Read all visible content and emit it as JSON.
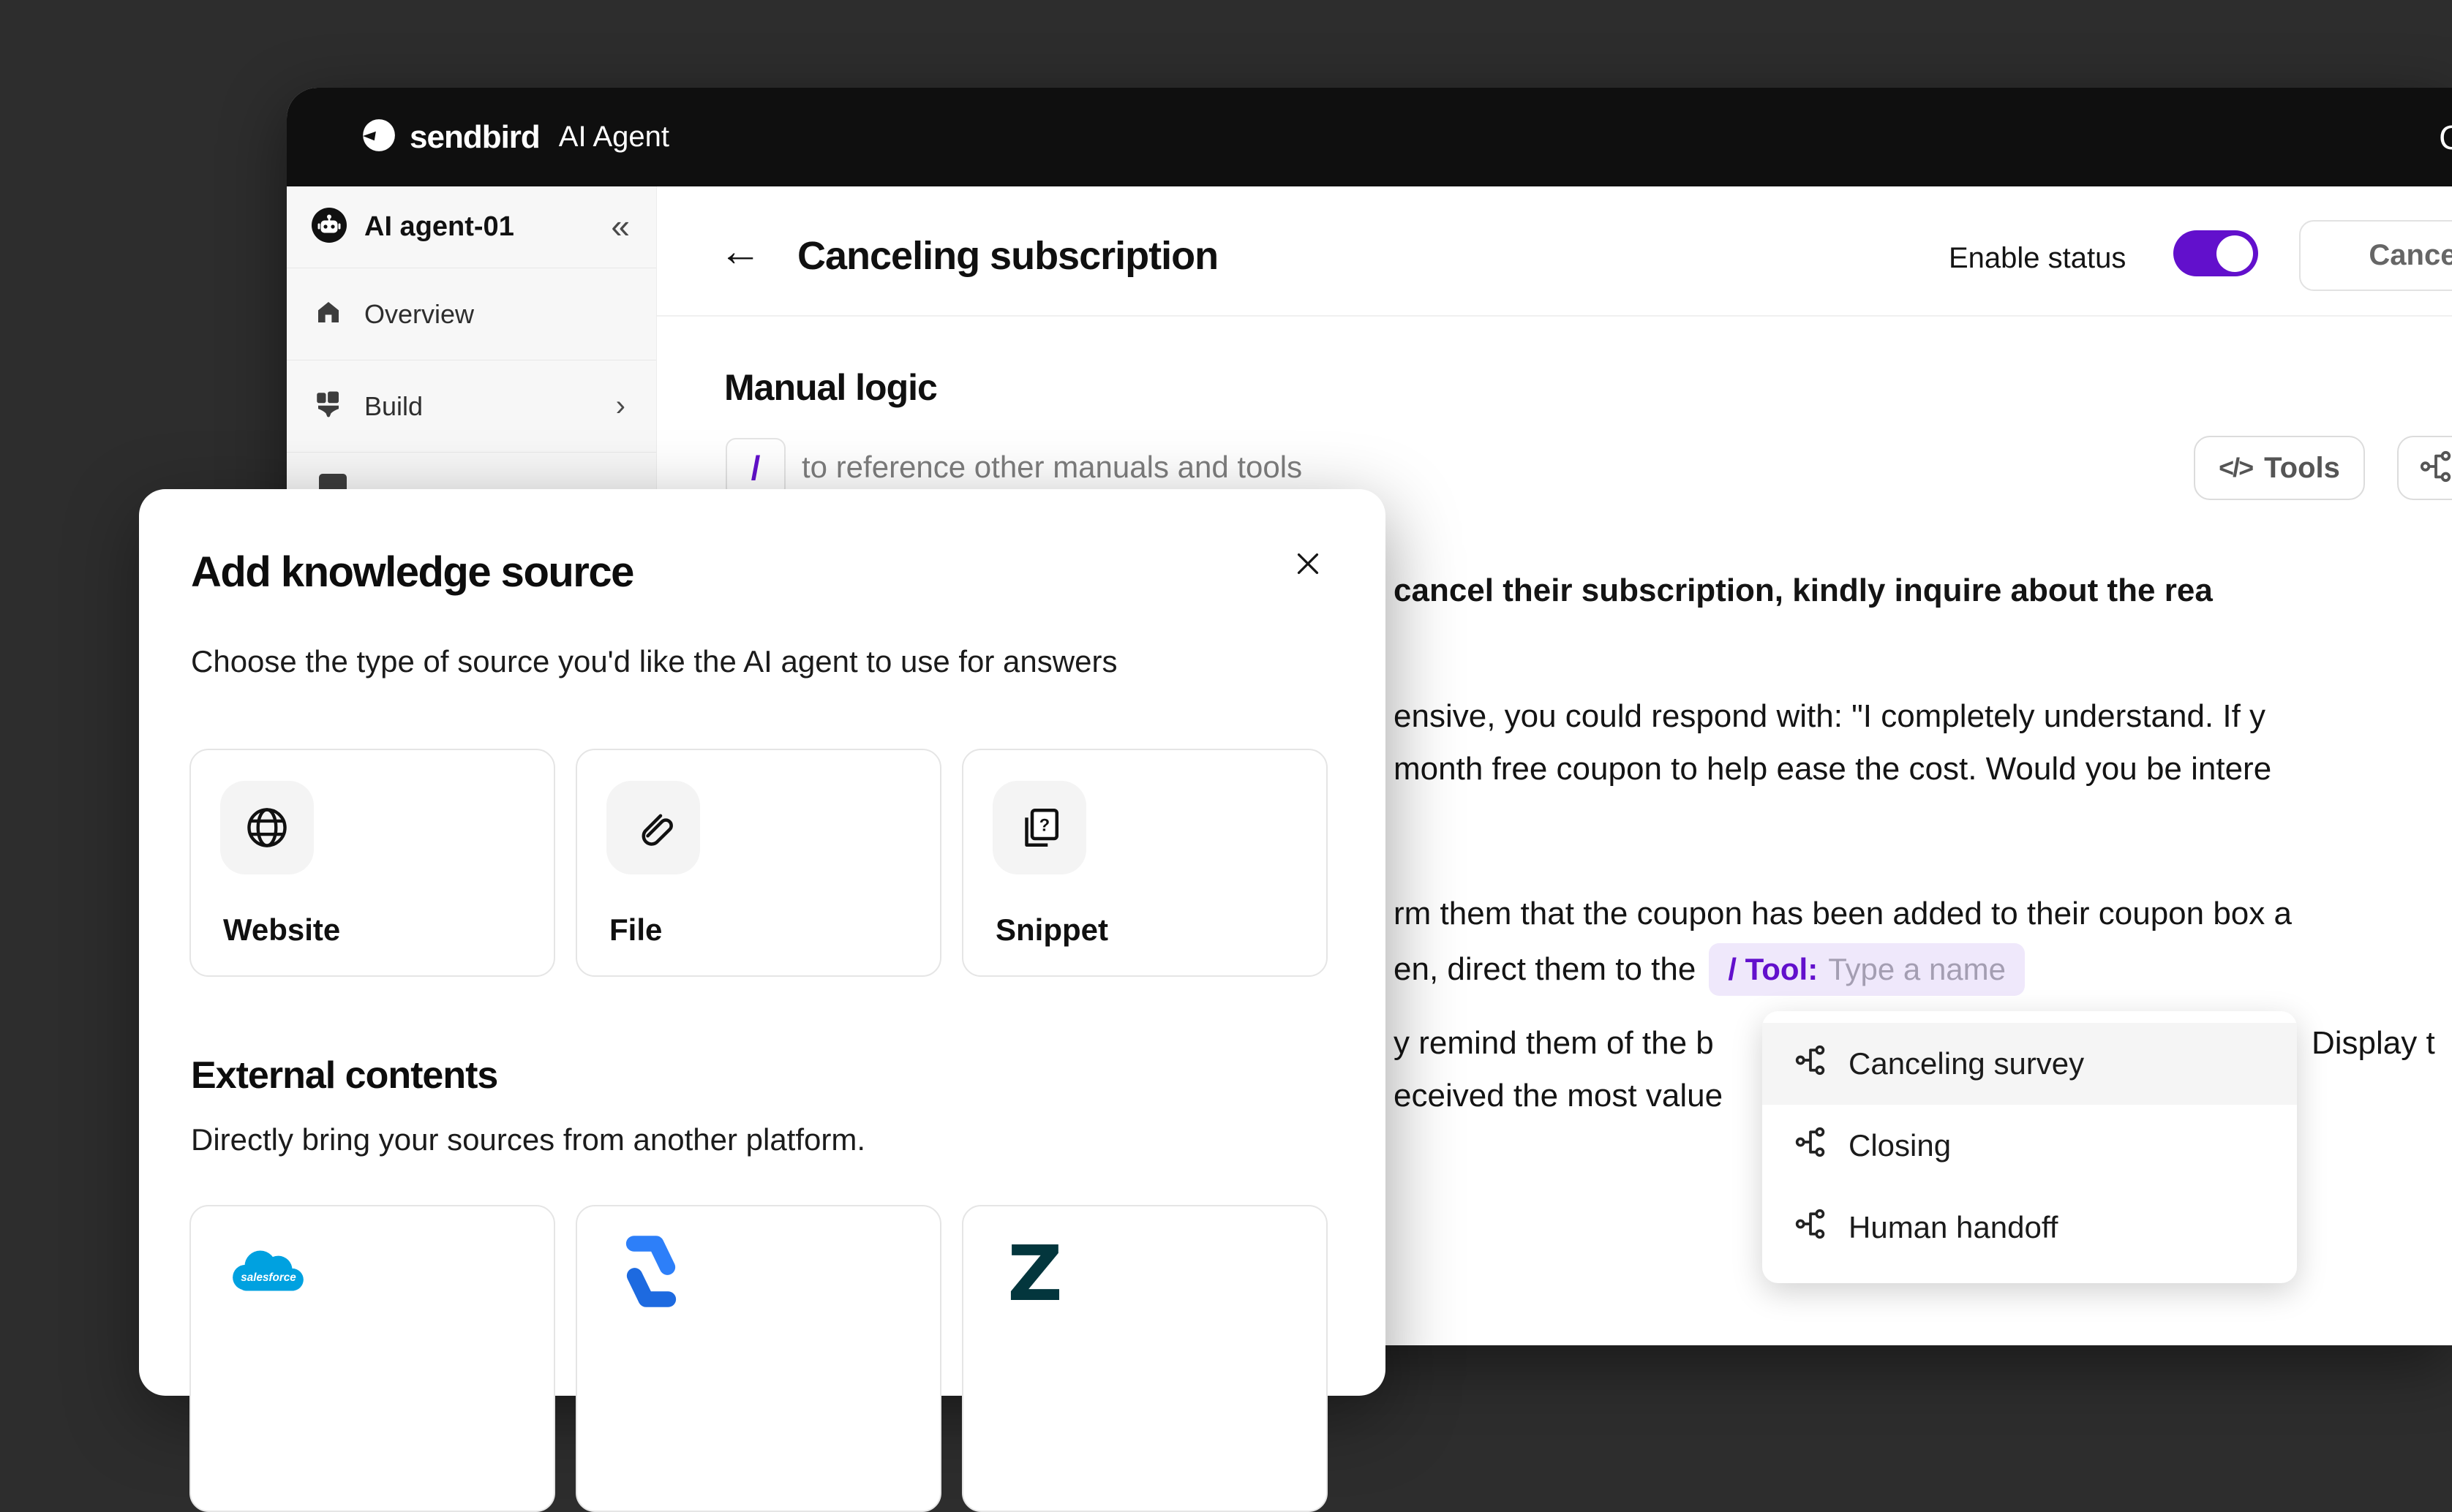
{
  "topbar": {
    "logo": "sendbird",
    "product": "AI Agent",
    "right_partial": "O"
  },
  "sidebar": {
    "agent_name": "AI agent-01",
    "collapse_glyph": "«",
    "items": [
      {
        "label": "Overview",
        "icon": "home-icon"
      },
      {
        "label": "Build",
        "icon": "brush-icon",
        "chevron": "›"
      }
    ]
  },
  "header": {
    "back_glyph": "←",
    "title": "Canceling subscription",
    "enable_status_label": "Enable status",
    "toggle_state": "on",
    "cancel_label": "Cancel"
  },
  "manual": {
    "section_title": "Manual logic",
    "slash": "/",
    "slash_hint": "to reference other manuals and tools",
    "tools_code_glyph": "</>",
    "tools_label": "Tools",
    "text": {
      "line1": "cancel their subscription, kindly inquire about the rea",
      "line2": "ensive, you could respond with: \"I completely understand. If y",
      "line3": "month free coupon to help ease the cost. Would you be intere",
      "line4": "rm them that the coupon has been added to their coupon box a",
      "line5_prefix": "en, direct them to the",
      "line6_left": "y remind them of the b",
      "line6_right": "Display t",
      "line7": "eceived the most value"
    },
    "tool_pill": {
      "trigger": "/ Tool:",
      "placeholder": "Type a name"
    },
    "dropdown": {
      "items": [
        "Canceling survey",
        "Closing",
        "Human handoff"
      ]
    }
  },
  "modal": {
    "title": "Add knowledge source",
    "subtitle": "Choose the type of source you'd like the AI agent to use for answers",
    "sources": [
      {
        "label": "Website",
        "icon": "globe-icon"
      },
      {
        "label": "File",
        "icon": "paperclip-icon"
      },
      {
        "label": "Snippet",
        "icon": "snippet-icon"
      }
    ],
    "external_title": "External contents",
    "external_subtitle": "Directly bring your sources from another platform.",
    "platforms": [
      {
        "icon": "salesforce-logo",
        "wordmark": "salesforce"
      },
      {
        "icon": "confluence-logo"
      },
      {
        "icon": "zendesk-logo",
        "glyph": "Z"
      }
    ]
  },
  "colors": {
    "accent_purple": "#6210CC",
    "topbar_bg": "#0F0F0F",
    "canvas_bg": "#2D2D2D",
    "sidebar_bg": "#F7F7F7",
    "pill_bg": "#EFE8FB",
    "salesforce_blue": "#00A1E0",
    "confluence_blue": "#2684FF",
    "zendesk_teal": "#03363D"
  }
}
